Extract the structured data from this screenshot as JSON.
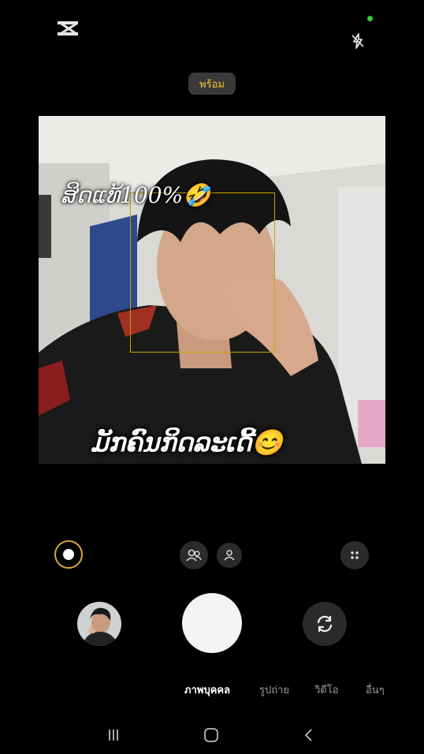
{
  "status": {
    "ready_label": "พร้อม"
  },
  "viewfinder": {
    "caption_top": "ສິດແທ້100%🤣",
    "caption_bottom": "ມັກຄົນກິດລະເດີ້😊"
  },
  "modes": {
    "items": [
      {
        "label": "ภาพบุคคล",
        "active": true
      },
      {
        "label": "รูปถ่าย",
        "active": false
      },
      {
        "label": "วิดีโอ",
        "active": false
      },
      {
        "label": "อื่นๆ",
        "active": false
      }
    ]
  },
  "icons": {
    "logo": "capcut-logo",
    "flash": "flash-off-icon",
    "camera_dot": "camera-active-indicator",
    "record": "record-icon",
    "pair": "two-people-icon",
    "single": "person-icon",
    "more": "grid-dots-icon",
    "switch": "camera-switch-icon",
    "nav_recent": "recent-apps-icon",
    "nav_home": "home-icon",
    "nav_back": "back-icon"
  },
  "colors": {
    "accent": "#f2c230",
    "focus_box": "#c8a400",
    "indicator": "#2ecc40"
  }
}
